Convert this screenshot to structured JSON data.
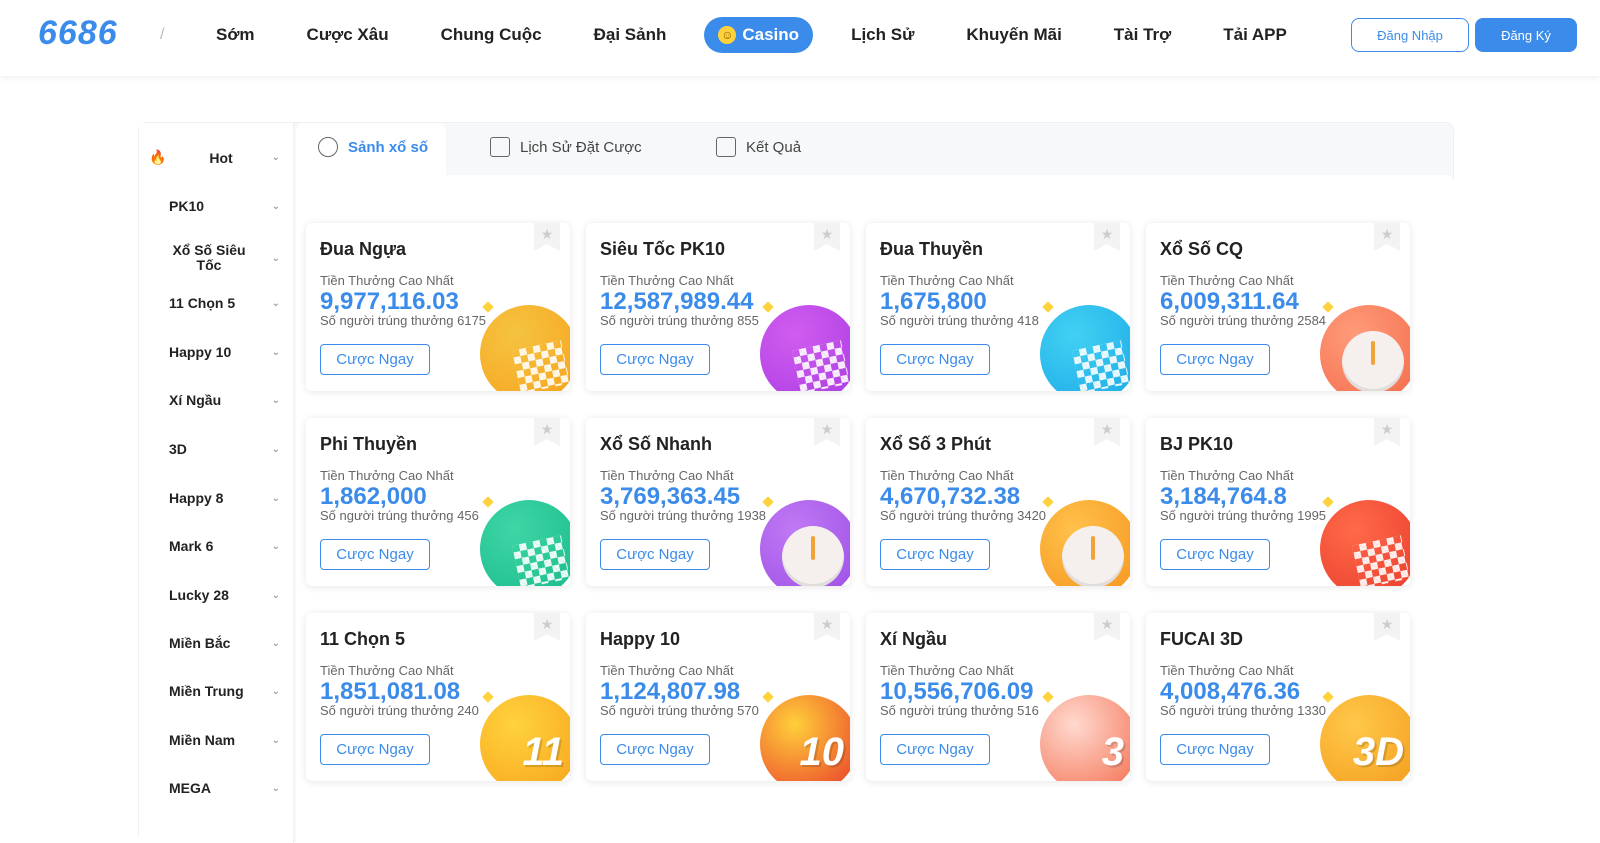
{
  "header": {
    "logo": "6686",
    "separator": "/",
    "nav": [
      "Sớm",
      "Cược Xâu",
      "Chung Cuộc",
      "Đại Sảnh",
      "Casino",
      "Lịch Sử",
      "Khuyến Mãi",
      "Tài Trợ",
      "Tải APP"
    ],
    "active_nav": "Casino",
    "login_label": "Đăng Nhập",
    "register_label": "Đăng Ký"
  },
  "sidebar": {
    "items": [
      {
        "label": "Hot",
        "icon": "fire-icon"
      },
      {
        "label": "PK10"
      },
      {
        "label": "Xổ Số Siêu Tốc"
      },
      {
        "label": "11 Chọn 5"
      },
      {
        "label": "Happy 10"
      },
      {
        "label": "Xí Ngầu"
      },
      {
        "label": "3D"
      },
      {
        "label": "Happy 8"
      },
      {
        "label": "Mark 6"
      },
      {
        "label": "Lucky 28"
      },
      {
        "label": "Miền Bắc"
      },
      {
        "label": "Miền Trung"
      },
      {
        "label": "Miền Nam"
      },
      {
        "label": "MEGA"
      }
    ]
  },
  "tabs": [
    {
      "label": "Sảnh xổ số",
      "icon": "lottery-hall-icon",
      "active": true
    },
    {
      "label": "Lịch Sử Đặt Cược",
      "icon": "document-icon",
      "active": false
    },
    {
      "label": "Kết Quả",
      "icon": "chart-icon",
      "active": false
    }
  ],
  "cards_common": {
    "prize_label": "Tiền Thưởng Cao Nhất",
    "bet_label": "Cược Ngay",
    "winners_prefix": "Số người trúng thưởng"
  },
  "cards": [
    {
      "title": "Đua Ngựa",
      "amount": "9,977,116.03",
      "winners": "6175",
      "art": "flag",
      "color": "#f7a21b",
      "accent": "#f5c341"
    },
    {
      "title": "Siêu Tốc PK10",
      "amount": "12,587,989.44",
      "winners": "855",
      "art": "flag",
      "color": "#a83be0",
      "accent": "#d15cf0"
    },
    {
      "title": "Đua Thuyền",
      "amount": "1,675,800",
      "winners": "418",
      "art": "flag",
      "color": "#1aa7e8",
      "accent": "#42d1f2"
    },
    {
      "title": "Xổ Số CQ",
      "amount": "6,009,311.64",
      "winners": "2584",
      "art": "clock",
      "color": "#f36a4a",
      "accent": "#ff9b7a"
    },
    {
      "title": "Phi Thuyền",
      "amount": "1,862,000",
      "winners": "456",
      "art": "flag",
      "color": "#17b98a",
      "accent": "#3fd6a6"
    },
    {
      "title": "Xổ Số Nhanh",
      "amount": "3,769,363.45",
      "winners": "1938",
      "art": "clock",
      "color": "#9b4ce6",
      "accent": "#c079f3"
    },
    {
      "title": "Xổ Số 3 Phút",
      "amount": "4,670,732.38",
      "winners": "3420",
      "art": "clock",
      "color": "#f5931e",
      "accent": "#ffc14a"
    },
    {
      "title": "BJ PK10",
      "amount": "3,184,764.8",
      "winners": "1995",
      "art": "flag",
      "color": "#e83a2a",
      "accent": "#ff6a4a"
    },
    {
      "title": "11 Chọn 5",
      "amount": "1,851,081.08",
      "winners": "240",
      "art": "text",
      "art_text": "11",
      "color": "#f7a21b",
      "accent": "#ffd23c"
    },
    {
      "title": "Happy 10",
      "amount": "1,124,807.98",
      "winners": "570",
      "art": "text",
      "art_text": "10",
      "color": "#e8342a",
      "accent": "#ffcf3a"
    },
    {
      "title": "Xí Ngầu",
      "amount": "10,556,706.09",
      "winners": "516",
      "art": "text",
      "art_text": "3",
      "color": "#f36a4a",
      "accent": "#ffd9cf"
    },
    {
      "title": "FUCAI 3D",
      "amount": "4,008,476.36",
      "winners": "1330",
      "art": "text",
      "art_text": "3D",
      "color": "#f39a1a",
      "accent": "#ffc84a"
    }
  ]
}
